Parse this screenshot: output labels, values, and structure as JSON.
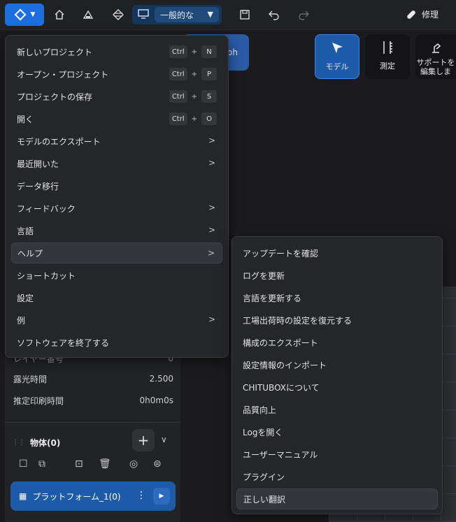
{
  "toolbar": {
    "view_mode": "一般的な",
    "repair_label": "修理"
  },
  "modes": {
    "model": "モデル",
    "measure": "測定",
    "support_line1": "サポートを",
    "support_line2": "編集しま",
    "partial_button": "ph"
  },
  "main_menu": {
    "items": [
      {
        "label": "新しいプロジェクト",
        "shortcut": [
          "Ctrl",
          "+",
          "N"
        ]
      },
      {
        "label": "オープン・プロジェクト",
        "shortcut": [
          "Ctrl",
          "+",
          "P"
        ]
      },
      {
        "label": "プロジェクトの保存",
        "shortcut": [
          "Ctrl",
          "+",
          "S"
        ]
      },
      {
        "label": "開く",
        "shortcut": [
          "Ctrl",
          "+",
          "O"
        ]
      },
      {
        "label": "モデルのエクスポート"
      },
      {
        "label": "最近開いた"
      },
      {
        "label": "データ移行"
      },
      {
        "label": "フィードバック"
      },
      {
        "label": "言語"
      },
      {
        "label": "ヘルプ"
      },
      {
        "label": "ショートカット"
      },
      {
        "label": "設定"
      },
      {
        "label": "例"
      },
      {
        "label": "ソフトウェアを終了する"
      }
    ]
  },
  "help_submenu": {
    "items": [
      "アップデートを確認",
      "ログを更新",
      "言語を更新する",
      "工場出荷時の設定を復元する",
      "構成のエクスポート",
      "設定情報のインポート",
      "CHITUBOXについて",
      "品質向上",
      "Logを開く",
      "ユーザーマニュアル",
      "プラグイン",
      "正しい翻訳"
    ]
  },
  "properties": {
    "layer_label": "レイヤー番号",
    "layer_value": "0",
    "exposure_label": "露光時間",
    "exposure_value": "2.500",
    "print_time_label": "推定印刷時間",
    "print_time_value": "0h0m0s"
  },
  "objects": {
    "header": "物体(0)",
    "platform_label": "プラットフォーム_1(0)"
  }
}
